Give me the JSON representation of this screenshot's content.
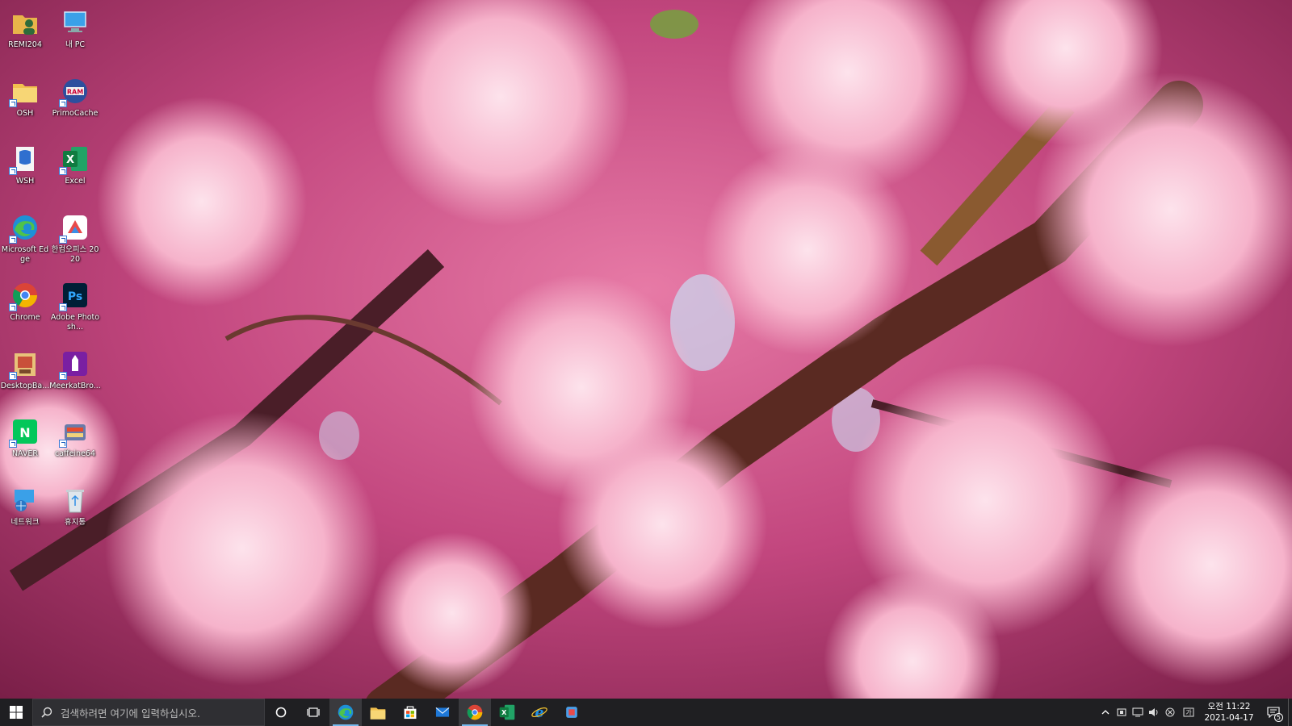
{
  "desktop": {
    "icons": [
      {
        "label": "REMI204",
        "icon": "user-folder-icon"
      },
      {
        "label": "내 PC",
        "icon": "computer-icon"
      },
      {
        "label": "OSH",
        "icon": "folder-icon"
      },
      {
        "label": "PrimoCache",
        "icon": "primocache-icon"
      },
      {
        "label": "WSH",
        "icon": "wsh-icon"
      },
      {
        "label": "Excel",
        "icon": "excel-icon"
      },
      {
        "label": "Microsoft Edge",
        "icon": "edge-icon"
      },
      {
        "label": "한컴오피스 2020",
        "icon": "hancom-office-icon"
      },
      {
        "label": "Chrome",
        "icon": "chrome-icon"
      },
      {
        "label": "Adobe Photosh...",
        "icon": "photoshop-icon"
      },
      {
        "label": "DesktopBa...",
        "icon": "desktop-backup-icon"
      },
      {
        "label": "MeerkatBro...",
        "icon": "meerkat-browser-icon"
      },
      {
        "label": "NAVER",
        "icon": "naver-icon"
      },
      {
        "label": "caffeine64",
        "icon": "caffeine-icon"
      },
      {
        "label": "네트워크",
        "icon": "network-icon"
      },
      {
        "label": "휴지통",
        "icon": "recycle-bin-icon"
      }
    ]
  },
  "taskbar": {
    "search_placeholder": "검색하려면 여기에 입력하십시오.",
    "apps": [
      {
        "name": "edge",
        "icon": "edge-icon",
        "running": true,
        "active": true
      },
      {
        "name": "file-explorer",
        "icon": "folder-icon",
        "running": false
      },
      {
        "name": "store",
        "icon": "store-icon",
        "running": false
      },
      {
        "name": "mail",
        "icon": "mail-icon",
        "running": false
      },
      {
        "name": "chrome",
        "icon": "chrome-icon",
        "running": true,
        "active": true
      },
      {
        "name": "excel",
        "icon": "excel-icon",
        "running": false
      },
      {
        "name": "internet-explorer",
        "icon": "ie-icon",
        "running": false
      },
      {
        "name": "unknown-app",
        "icon": "app-icon",
        "running": false
      }
    ],
    "clock": {
      "time": "오전 11:22",
      "date": "2021-04-17"
    },
    "notification_count": "5"
  },
  "colors": {
    "taskbar": "#1f1f22",
    "accent": "#76b9ed",
    "blossom": "#f4a7c0"
  }
}
